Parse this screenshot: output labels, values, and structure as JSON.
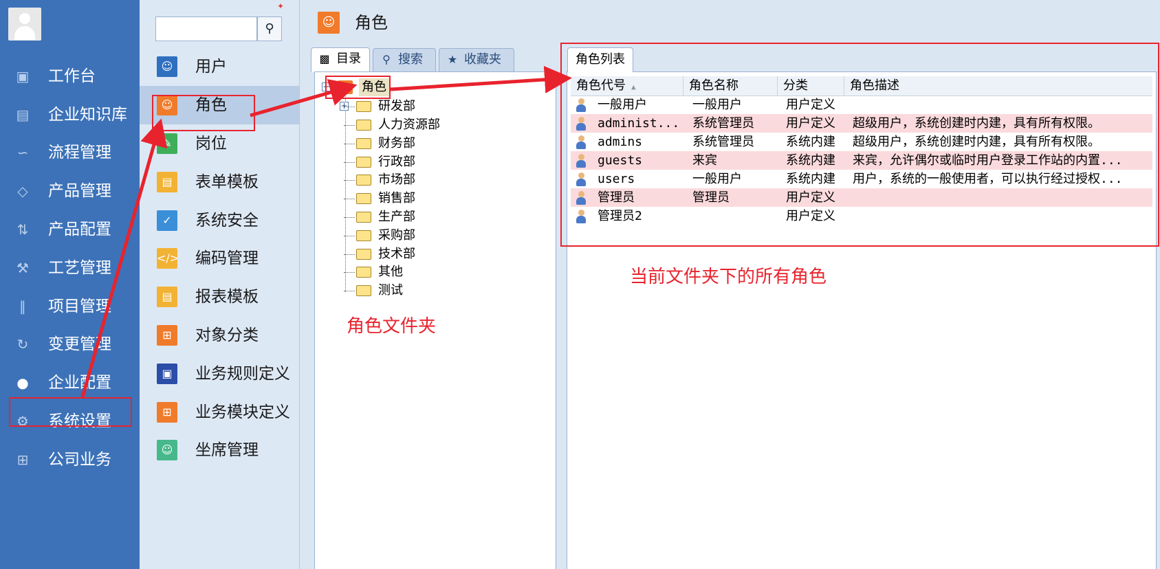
{
  "nav": {
    "items": [
      {
        "label": "工作台",
        "icon": "monitor-icon"
      },
      {
        "label": "企业知识库",
        "icon": "book-icon"
      },
      {
        "label": "流程管理",
        "icon": "flow-icon"
      },
      {
        "label": "产品管理",
        "icon": "cube-icon"
      },
      {
        "label": "产品配置",
        "icon": "sliders-icon"
      },
      {
        "label": "工艺管理",
        "icon": "wrench-icon"
      },
      {
        "label": "项目管理",
        "icon": "bars-icon"
      },
      {
        "label": "变更管理",
        "icon": "refresh-icon"
      },
      {
        "label": "企业配置",
        "icon": "users-icon",
        "active": true
      },
      {
        "label": "系统设置",
        "icon": "gear-icon"
      },
      {
        "label": "公司业务",
        "icon": "grid-icon"
      }
    ]
  },
  "panel2": {
    "search_value": "",
    "items": [
      {
        "label": "用户",
        "color": "#2f6fc0",
        "icon": "user-icon"
      },
      {
        "label": "角色",
        "color": "#f07b2a",
        "icon": "role-icon",
        "selected": true
      },
      {
        "label": "岗位",
        "color": "#3fae5a",
        "icon": "post-icon"
      },
      {
        "label": "表单模板",
        "color": "#f2b233",
        "icon": "form-icon"
      },
      {
        "label": "系统安全",
        "color": "#3a8fd8",
        "icon": "shield-icon"
      },
      {
        "label": "编码管理",
        "color": "#f2b233",
        "icon": "code-icon"
      },
      {
        "label": "报表模板",
        "color": "#f2b233",
        "icon": "report-icon"
      },
      {
        "label": "对象分类",
        "color": "#f07b2a",
        "icon": "category-icon"
      },
      {
        "label": "业务规则定义",
        "color": "#2b4ea8",
        "icon": "rule-icon"
      },
      {
        "label": "业务模块定义",
        "color": "#f07b2a",
        "icon": "module-icon"
      },
      {
        "label": "坐席管理",
        "color": "#46b88a",
        "icon": "seat-icon"
      }
    ]
  },
  "main": {
    "title": "角色",
    "title_color": "#f07b2a"
  },
  "tree": {
    "tabs": [
      {
        "label": "目录",
        "icon": "computer-icon"
      },
      {
        "label": "搜索",
        "icon": "search-icon"
      },
      {
        "label": "收藏夹",
        "icon": "favorites-icon"
      }
    ],
    "root": "角色",
    "nodes": [
      "研发部",
      "人力资源部",
      "财务部",
      "行政部",
      "市场部",
      "销售部",
      "生产部",
      "采购部",
      "技术部",
      "其他",
      "测试"
    ]
  },
  "grid": {
    "tab": "角色列表",
    "columns": [
      "角色代号",
      "角色名称",
      "分类",
      "角色描述"
    ],
    "rows": [
      [
        "一般用户",
        "一般用户",
        "用户定义",
        ""
      ],
      [
        "administ...",
        "系统管理员",
        "用户定义",
        "超级用户，系统创建时内建，具有所有权限。"
      ],
      [
        "admins",
        "系统管理员",
        "系统内建",
        "超级用户，系统创建时内建，具有所有权限。"
      ],
      [
        "guests",
        "来宾",
        "系统内建",
        "来宾，允许偶尔或临时用户登录工作站的内置..."
      ],
      [
        "users",
        "一般用户",
        "系统内建",
        "用户，系统的一般使用者，可以执行经过授权..."
      ],
      [
        "管理员",
        "管理员",
        "用户定义",
        ""
      ],
      [
        "管理员2",
        "",
        "用户定义",
        ""
      ]
    ]
  },
  "annotations": {
    "folder_note": "角色文件夹",
    "list_note": "当前文件夹下的所有角色",
    "color": "#e8232d"
  }
}
